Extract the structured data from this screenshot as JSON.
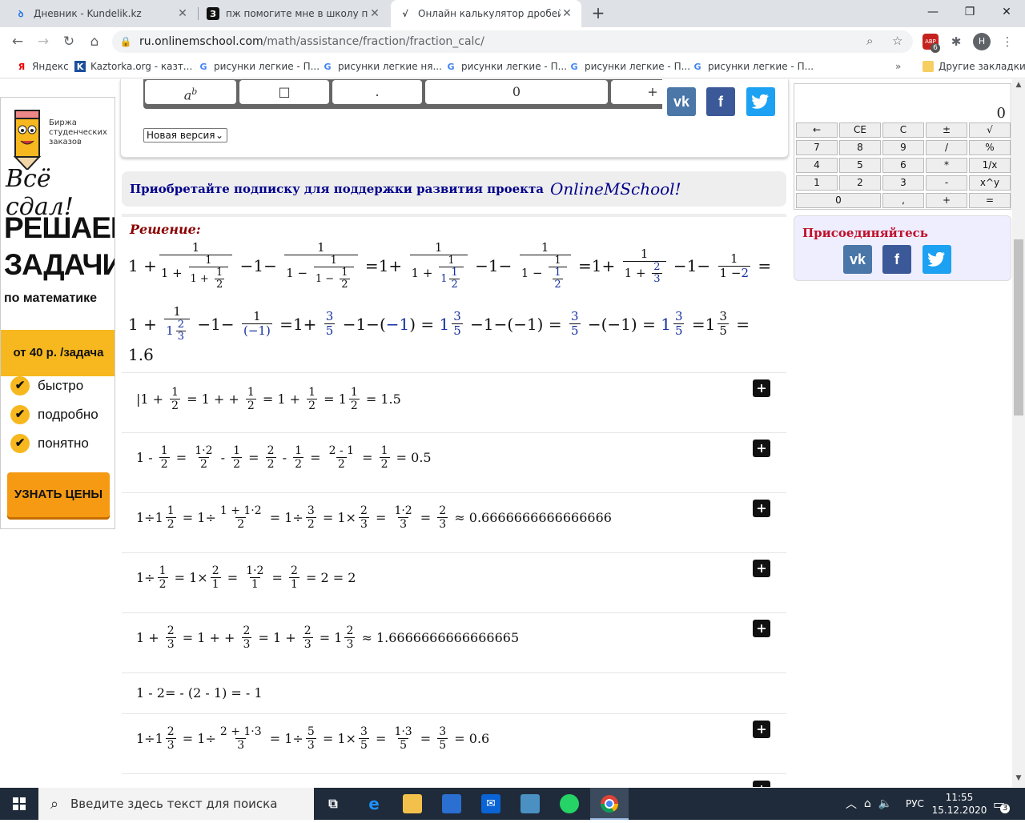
{
  "browser": {
    "tabs": [
      {
        "title": "Дневник - Kundelik.kz",
        "icon": "kundelik-icon"
      },
      {
        "title": "пж помогите мне в школу пора",
        "icon": "znanija-icon"
      },
      {
        "title": "Онлайн калькулятор дробей. Вы",
        "icon": "onlinemschool-icon"
      }
    ],
    "url_host": "ru.onlinemschool.com",
    "url_path": "/math/assistance/fraction/fraction_calc/",
    "profile_letter": "H",
    "ext_badge": "6",
    "ext_label": "ABP",
    "bookmarks": [
      "Яндекс",
      "Kaztorka.org - казт...",
      "рисунки легкие - П...",
      "рисунки легкие  ня...",
      "рисунки легкие - П...",
      "рисунки легкие - П...",
      "рисунки легкие - П..."
    ],
    "other_bookmarks": "Другие закладки"
  },
  "ad": {
    "brand": "Биржа студенческих заказов",
    "slogan": "Всё сдал!",
    "headline1": "РЕШАЕМ",
    "headline2": "ЗАДАЧИ",
    "subline": "по математике",
    "price": "от 40 р. /задача",
    "features": [
      "быстро",
      "подробно",
      "понятно"
    ],
    "cta": "УЗНАТЬ ЦЕНЫ"
  },
  "calc_panel": {
    "keys": [
      "a",
      "b",
      "□",
      ".",
      "0",
      "+"
    ],
    "version_select": "Новая версия"
  },
  "social": {
    "vk": "vk",
    "fb": "f"
  },
  "subscribe": {
    "text": "Приобретайте подписку для поддержки развития проекта",
    "brand": "OnlineMSchool!"
  },
  "solution": {
    "title": "Решение:",
    "tokens": {
      "one": "1",
      "plus": "+",
      "minus": "−",
      "eq": "=",
      "two": "2",
      "three": "3",
      "five": "5",
      "m1": "(−1)",
      "m1b": "−1",
      "one6": "1.6"
    }
  },
  "steps": [
    {
      "result": "1.5",
      "plus": "+"
    },
    {
      "result": "0.5",
      "plus": "+"
    },
    {
      "result": "≈ 0.6666666666666666",
      "plus": "+"
    },
    {
      "result": "2",
      "plus": "+"
    },
    {
      "result": "≈ 1.6666666666666665",
      "plus": "+"
    },
    {
      "text": "1 - 2= - (2 - 1) = - 1"
    },
    {
      "result": "0.6",
      "plus": "+"
    }
  ],
  "right_calc": {
    "display": "0",
    "keys": [
      "←",
      "CE",
      "C",
      "±",
      "√",
      "7",
      "8",
      "9",
      "/",
      "%",
      "4",
      "5",
      "6",
      "*",
      "1/x",
      "1",
      "2",
      "3",
      "-",
      "x^y",
      "0",
      ",",
      "+",
      "="
    ]
  },
  "join": {
    "title": "Присоединяйтесь"
  },
  "taskbar": {
    "search_placeholder": "Введите здесь текст для поиска",
    "lang": "РУС",
    "time": "11:55",
    "date": "15.12.2020",
    "notif_count": "3"
  }
}
